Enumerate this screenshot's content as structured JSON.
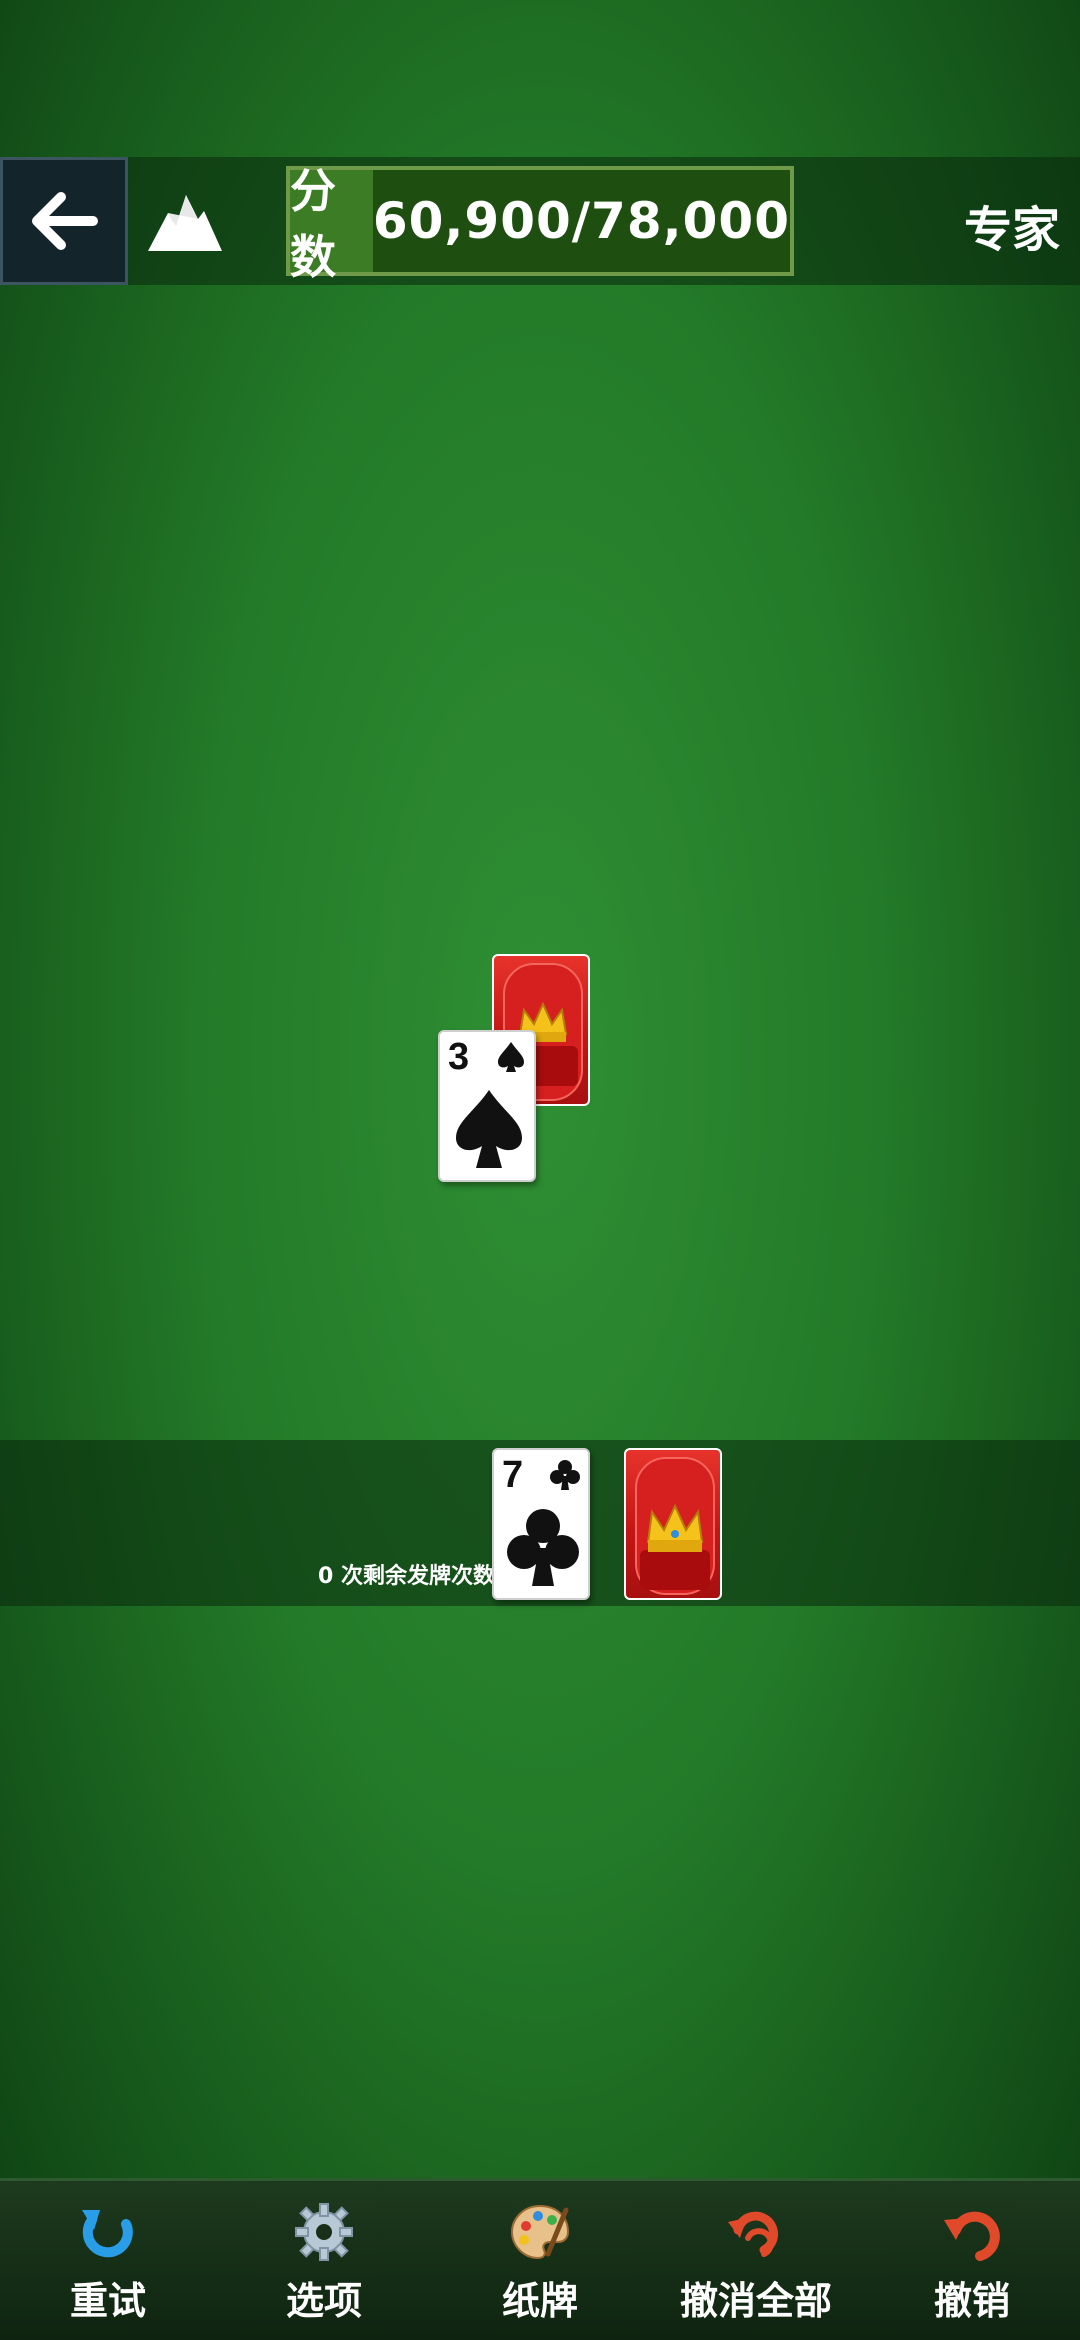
{
  "header": {
    "score_label": "分数",
    "score_value": "60,900/78,000",
    "difficulty": "专家",
    "back_icon": "arrow-left-icon",
    "mode_icon": "mountain-icon"
  },
  "tableau": {
    "cards": [
      {
        "rank": "3",
        "suit": "spade",
        "face_up": true
      },
      {
        "face_up": false
      }
    ]
  },
  "stock": {
    "redeals_text": "0 次剩余发牌次数",
    "waste_card": {
      "rank": "7",
      "suit": "club"
    },
    "pile": "face-down"
  },
  "toolbar": {
    "items": [
      {
        "label": "重试",
        "icon": "retry-icon"
      },
      {
        "label": "选项",
        "icon": "gear-icon"
      },
      {
        "label": "纸牌",
        "icon": "palette-icon"
      },
      {
        "label": "撤消全部",
        "icon": "undo-all-icon"
      },
      {
        "label": "撤销",
        "icon": "undo-icon"
      }
    ]
  },
  "colors": {
    "felt": "#237a28",
    "card_back": "#c21616",
    "score_border": "#6f9a4a"
  }
}
